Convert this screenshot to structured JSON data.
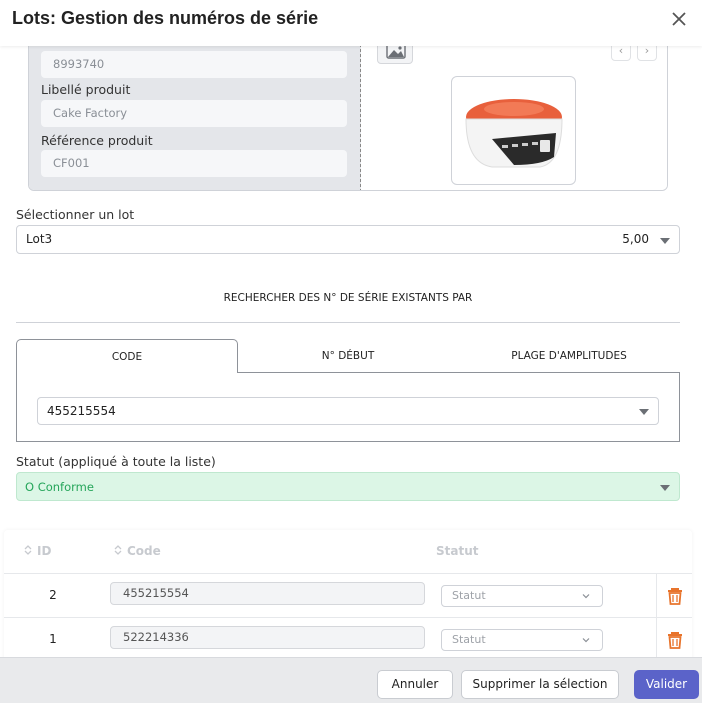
{
  "dialog": {
    "title": "Lots: Gestion des numéros de série"
  },
  "product": {
    "top_field_value": "8993740",
    "libelle_label": "Libellé produit",
    "libelle_value": "Cake Factory",
    "reference_label": "Référence produit",
    "reference_value": "CF001"
  },
  "lot": {
    "label": "Sélectionner un lot",
    "selected_name": "Lot3",
    "selected_quantity": "5,00"
  },
  "search": {
    "heading": "RECHERCHER DES N° DE SÉRIE EXISTANTS PAR",
    "tabs": [
      {
        "label": "CODE",
        "active": true
      },
      {
        "label": "N° DÉBUT",
        "active": false
      },
      {
        "label": "PLAGE D'AMPLITUDES",
        "active": false
      }
    ],
    "code_value": "455215554"
  },
  "statut": {
    "label": "Statut (appliqué à toute la liste)",
    "value": "O Conforme",
    "color": "#25a55a"
  },
  "table": {
    "headers": {
      "id": "ID",
      "code": "Code",
      "statut": "Statut"
    },
    "rows": [
      {
        "id": "2",
        "code": "455215554",
        "statut_placeholder": "Statut"
      },
      {
        "id": "1",
        "code": "522214336",
        "statut_placeholder": "Statut"
      }
    ]
  },
  "footer": {
    "cancel_label": "Annuler",
    "delete_selection_label": "Supprimer la sélection",
    "validate_label": "Valider"
  },
  "colors": {
    "primary": "#5b63c9",
    "trash": "#e8742c",
    "status_bg": "#dcf6e6"
  },
  "icons": [
    "close-icon",
    "image-icon",
    "chevron-left-icon",
    "chevron-right-icon",
    "caret-down-icon",
    "sort-icon",
    "chevron-down-icon",
    "trash-icon"
  ]
}
